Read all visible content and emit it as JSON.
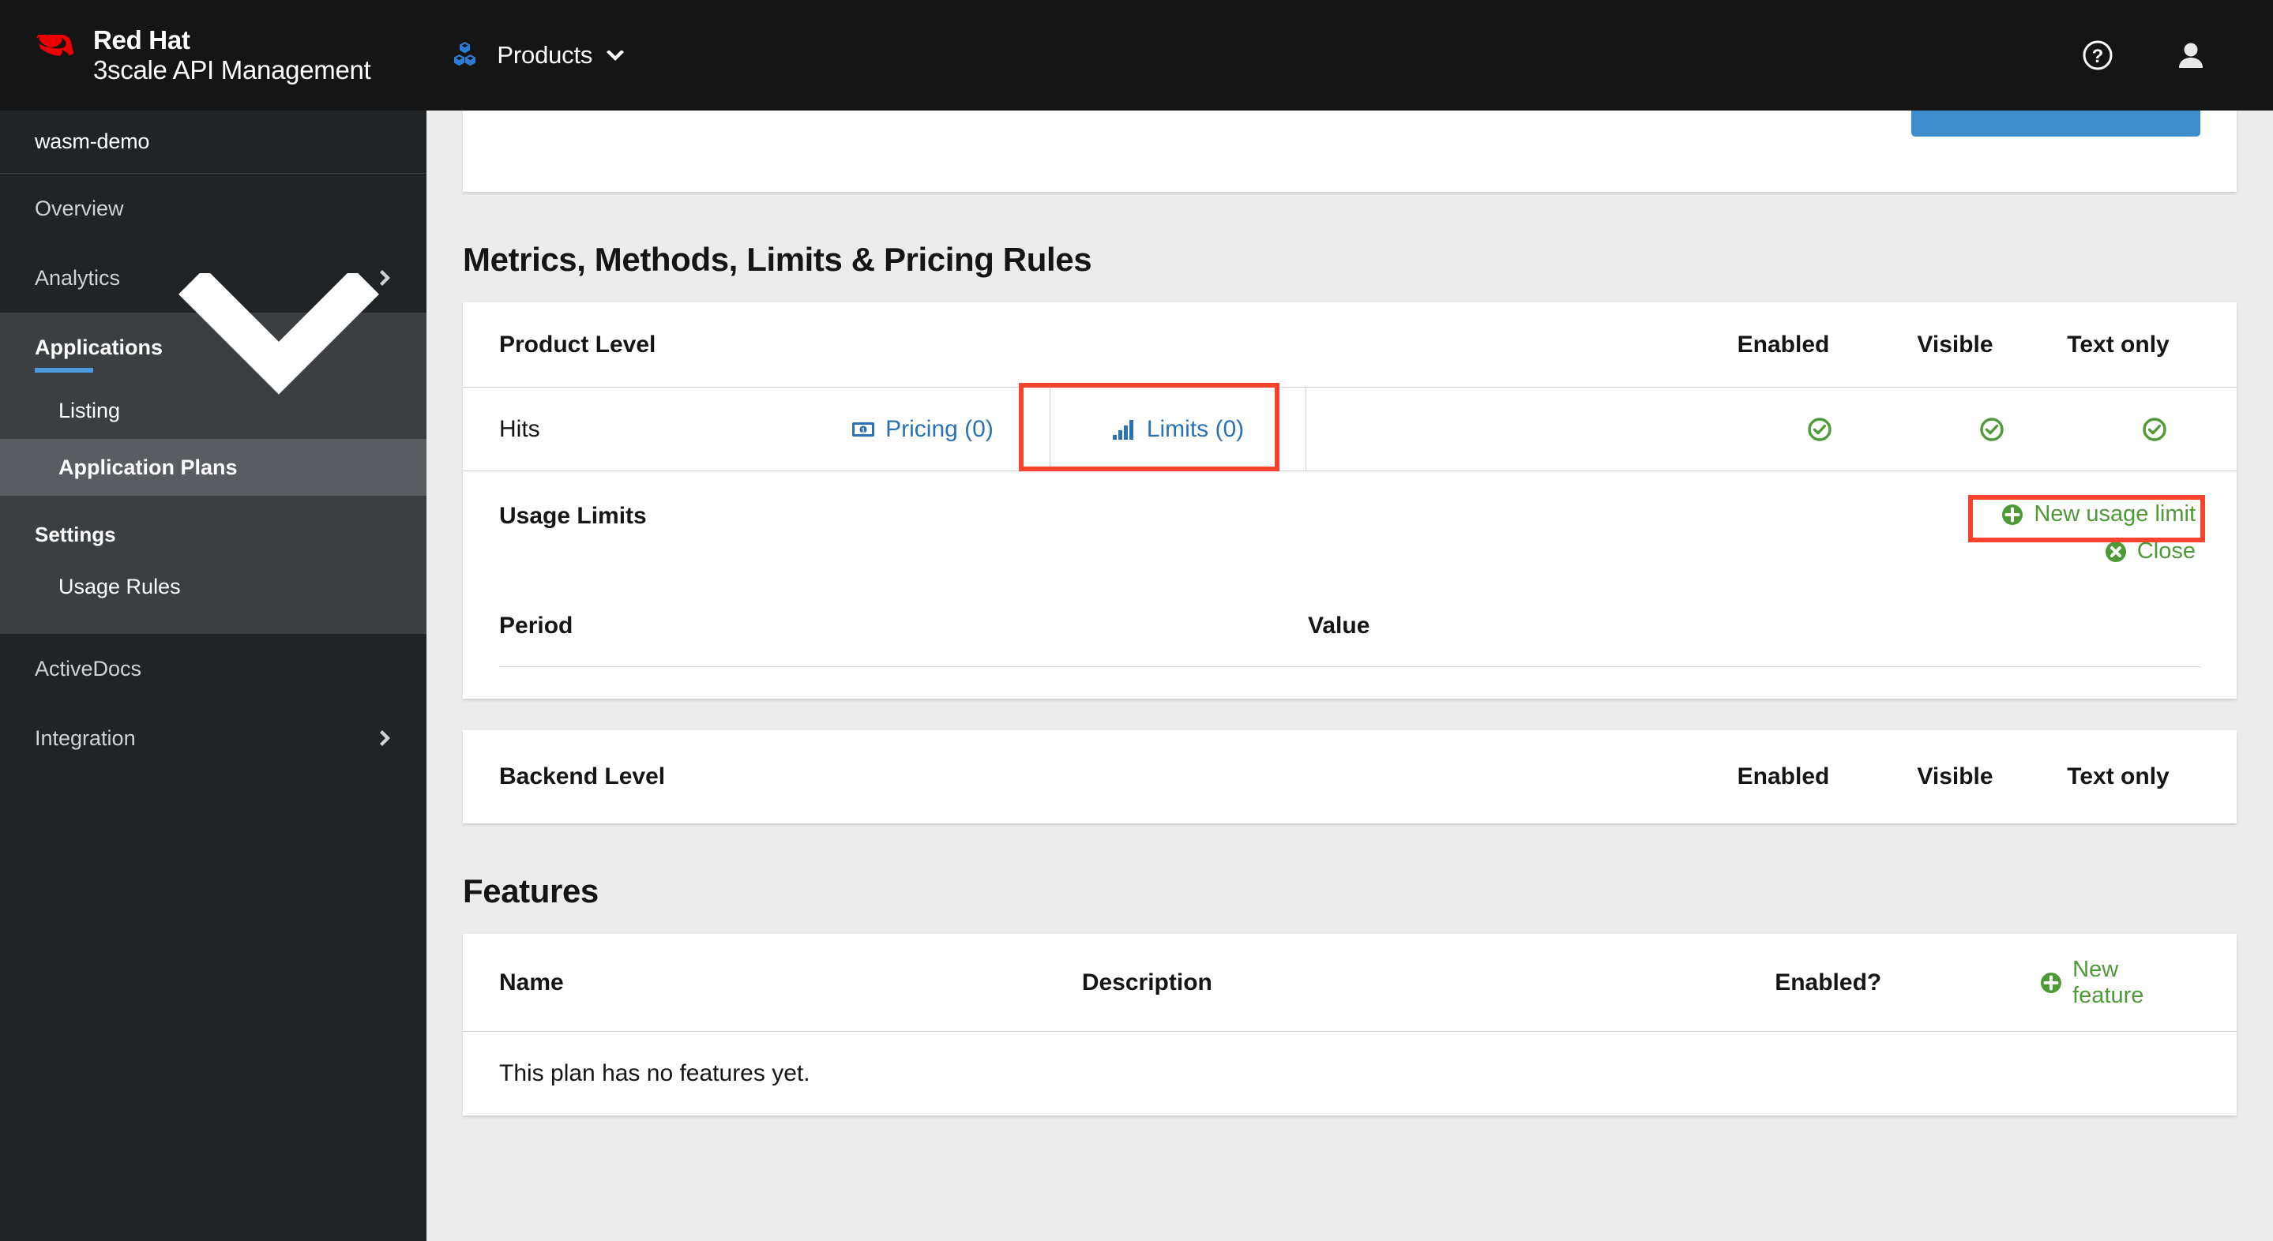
{
  "masthead": {
    "brand_top": "Red Hat",
    "brand_bottom": "3scale API Management",
    "products_label": "Products",
    "help_icon": "help-circle-icon",
    "user_icon": "user-avatar-icon",
    "logo_icon": "redhat-fedora-logo",
    "products_icon": "cubes-icon",
    "caret_icon": "chevron-down-icon"
  },
  "sidebar": {
    "product_name": "wasm-demo",
    "items": [
      {
        "label": "Overview",
        "arrow": ""
      },
      {
        "label": "Analytics",
        "arrow": "chevron-right-icon"
      }
    ],
    "group": {
      "label": "Applications",
      "arrow": "chevron-down-icon",
      "children": [
        {
          "label": "Listing",
          "active": false
        },
        {
          "label": "Application Plans",
          "active": true
        }
      ],
      "section_title": "Settings",
      "section_items": [
        {
          "label": "Usage Rules"
        }
      ]
    },
    "items_after": [
      {
        "label": "ActiveDocs",
        "arrow": ""
      },
      {
        "label": "Integration",
        "arrow": "chevron-right-icon"
      }
    ]
  },
  "main": {
    "top_button_label": "",
    "metrics_section": {
      "title": "Metrics, Methods, Limits & Pricing Rules",
      "product_level": {
        "label": "Product Level",
        "columns": [
          "Enabled",
          "Visible",
          "Text only"
        ]
      },
      "metric_row": {
        "name": "Hits",
        "pricing_label": "Pricing (0)",
        "pricing_icon": "money-bill-icon",
        "limits_label": "Limits (0)",
        "limits_icon": "bar-chart-icon",
        "enabled": "check-circle-icon",
        "visible": "check-circle-icon",
        "text_only": "check-circle-icon"
      },
      "usage_limits": {
        "title": "Usage Limits",
        "new_label": "New usage limit",
        "new_icon": "plus-circle-icon",
        "close_label": "Close",
        "close_icon": "times-circle-icon",
        "columns": {
          "period": "Period",
          "value": "Value"
        },
        "rows": []
      },
      "backend_level": {
        "label": "Backend Level",
        "columns": [
          "Enabled",
          "Visible",
          "Text only"
        ]
      }
    },
    "features_section": {
      "title": "Features",
      "columns": {
        "name": "Name",
        "description": "Description",
        "enabled": "Enabled?"
      },
      "new_feature_label": "New feature",
      "new_feature_icon": "plus-circle-icon",
      "empty_message": "This plan has no features yet."
    }
  },
  "colors": {
    "masthead_bg": "#151515",
    "sidebar_bg": "#212427",
    "sidebar_group_bg": "#3c3f42",
    "sidebar_active_bg": "#595c60",
    "accent_blue": "#4d9ae0",
    "link_blue": "#2a72b5",
    "button_blue": "#3d8ccc",
    "green": "#4d9a36",
    "highlight_red": "#f4442e",
    "page_bg": "#ececec",
    "redhat_red": "#ee0000"
  }
}
